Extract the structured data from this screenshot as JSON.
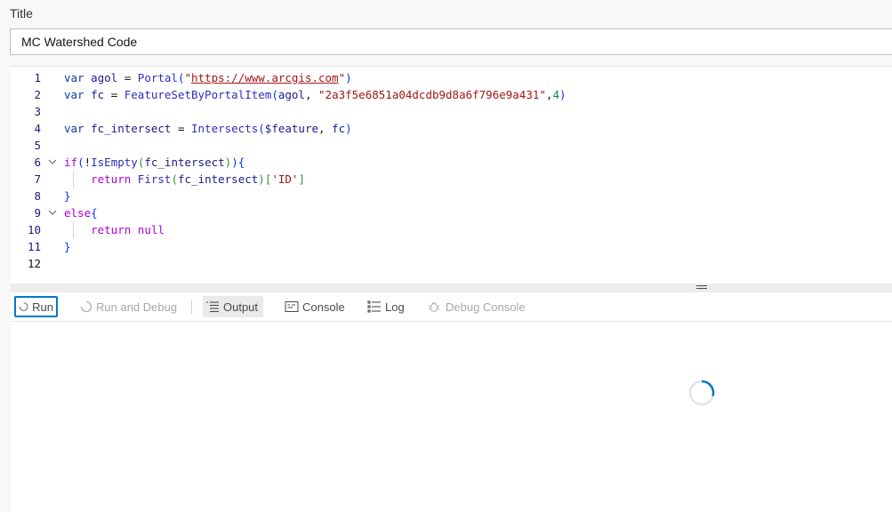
{
  "title_field": {
    "label": "Title",
    "value": "MC Watershed Code"
  },
  "editor": {
    "line_numbers": [
      "1",
      "2",
      "3",
      "4",
      "5",
      "6",
      "7",
      "8",
      "9",
      "10",
      "11",
      "12"
    ],
    "lines": [
      "var agol = Portal(\"https://www.arcgis.com\")",
      "var fc = FeatureSetByPortalItem(agol, \"2a3f5e6851a04dcdb9d8a6f796e9a431\",4)",
      "",
      "var fc_intersect = Intersects($feature, fc)",
      "",
      "if(!IsEmpty(fc_intersect)){",
      "    return First(fc_intersect)['ID']",
      "}",
      "else{",
      "    return null",
      "}",
      ""
    ],
    "foldable_lines": [
      "6",
      "9"
    ]
  },
  "toolbar": {
    "run_label": "Run",
    "run_debug_label": "Run and Debug",
    "output_label": "Output",
    "console_label": "Console",
    "log_label": "Log",
    "debug_console_label": "Debug Console",
    "icons": {
      "run": "spinner-icon",
      "run_debug": "spinner-icon",
      "output": "list-icon",
      "console": "console-icon",
      "log": "log-list-icon",
      "debug_console": "bug-icon"
    }
  },
  "output": {
    "status": "loading"
  },
  "colors": {
    "accent": "#007ac2",
    "keyword": "#0d3ba0",
    "string": "#a31515",
    "number": "#098658",
    "control": "#af00db"
  }
}
